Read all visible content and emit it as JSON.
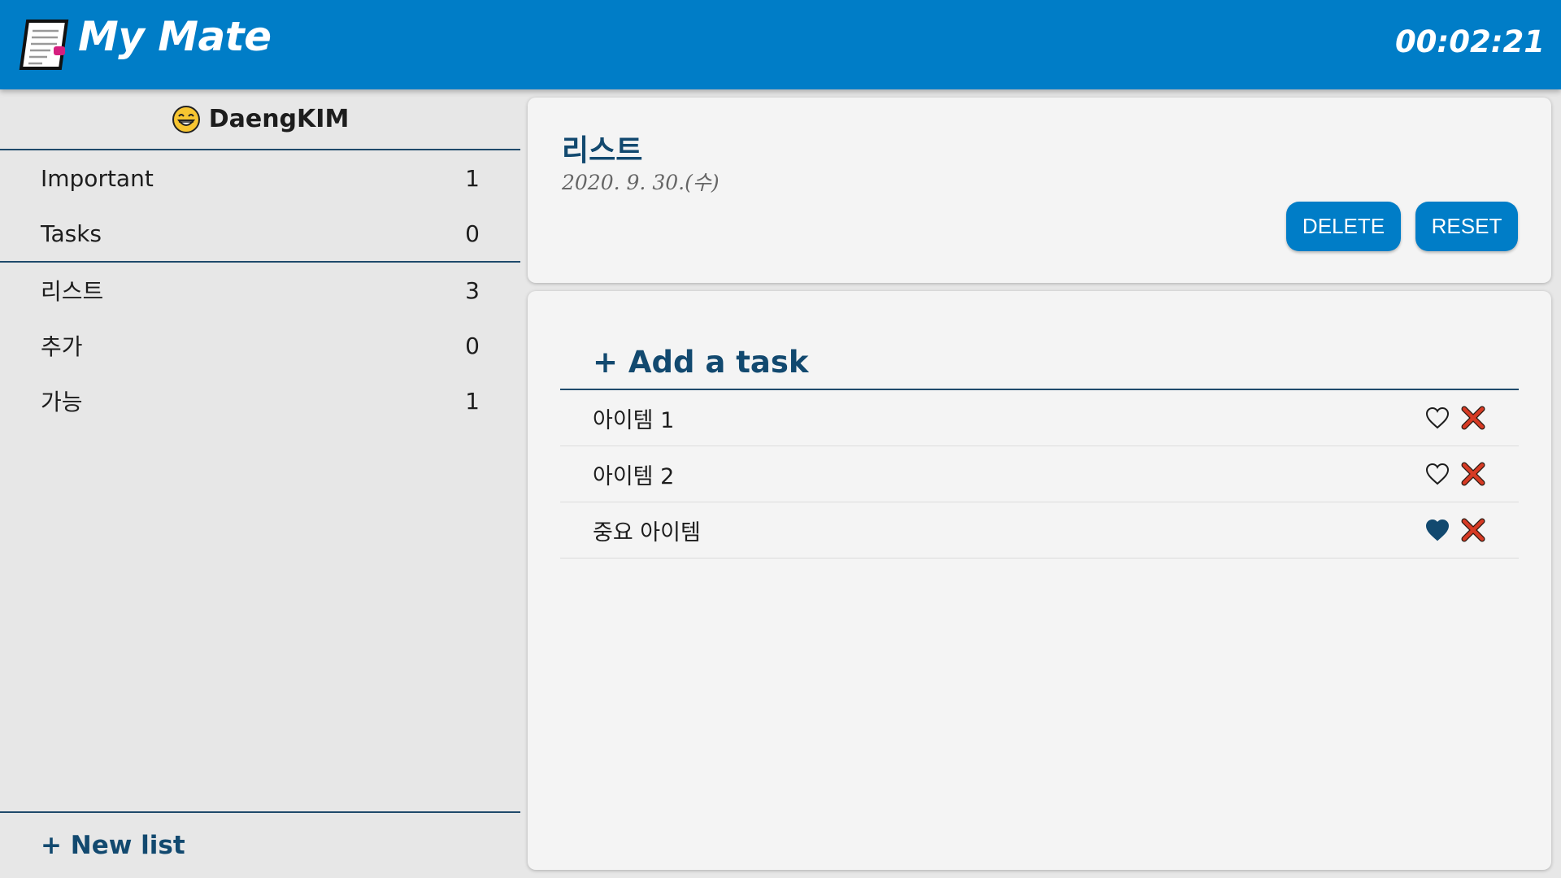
{
  "header": {
    "app_title": "My Mate",
    "clock": "00:02:21",
    "logo_icon": "notepad-icon"
  },
  "sidebar": {
    "user": {
      "avatar_icon": "grinning-emoji-icon",
      "name": "DaengKIM"
    },
    "default_lists": [
      {
        "label": "Important",
        "count": "1"
      },
      {
        "label": "Tasks",
        "count": "0"
      }
    ],
    "custom_lists": [
      {
        "label": "리스트",
        "count": "3"
      },
      {
        "label": "추가",
        "count": "0"
      },
      {
        "label": "가능",
        "count": "1"
      }
    ],
    "new_list_label": "+ New list"
  },
  "main": {
    "list_title": "리스트",
    "list_date": "2020. 9. 30.(수)",
    "delete_label": "DELETE",
    "reset_label": "RESET",
    "add_task_label": "+ Add a task",
    "tasks": [
      {
        "label": "아이템 1",
        "important": false
      },
      {
        "label": "아이템 2",
        "important": false
      },
      {
        "label": "중요 아이템",
        "important": true
      }
    ]
  },
  "colors": {
    "brand": "#007dc7",
    "accent_text": "#12496f",
    "delete_x": "#d63a24"
  }
}
